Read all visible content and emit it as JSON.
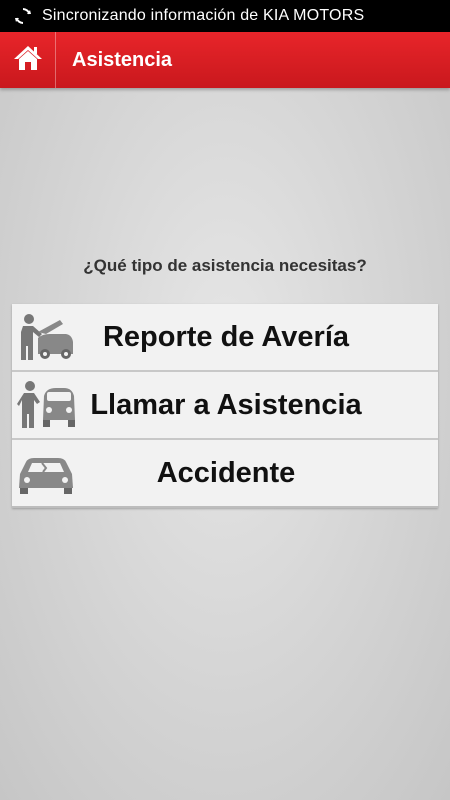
{
  "status_bar": {
    "text": "Sincronizando información de KIA MOTORS",
    "icon": "sync-icon"
  },
  "app_bar": {
    "title": "Asistencia",
    "home_icon": "home-icon",
    "color": "#d81f24"
  },
  "question": "¿Qué tipo de asistencia necesitas?",
  "options": [
    {
      "label": "Reporte de Avería",
      "icon": "car-breakdown-icon"
    },
    {
      "label": "Llamar a Asistencia",
      "icon": "roadside-assistance-icon"
    },
    {
      "label": "Accidente",
      "icon": "car-accident-icon"
    }
  ]
}
